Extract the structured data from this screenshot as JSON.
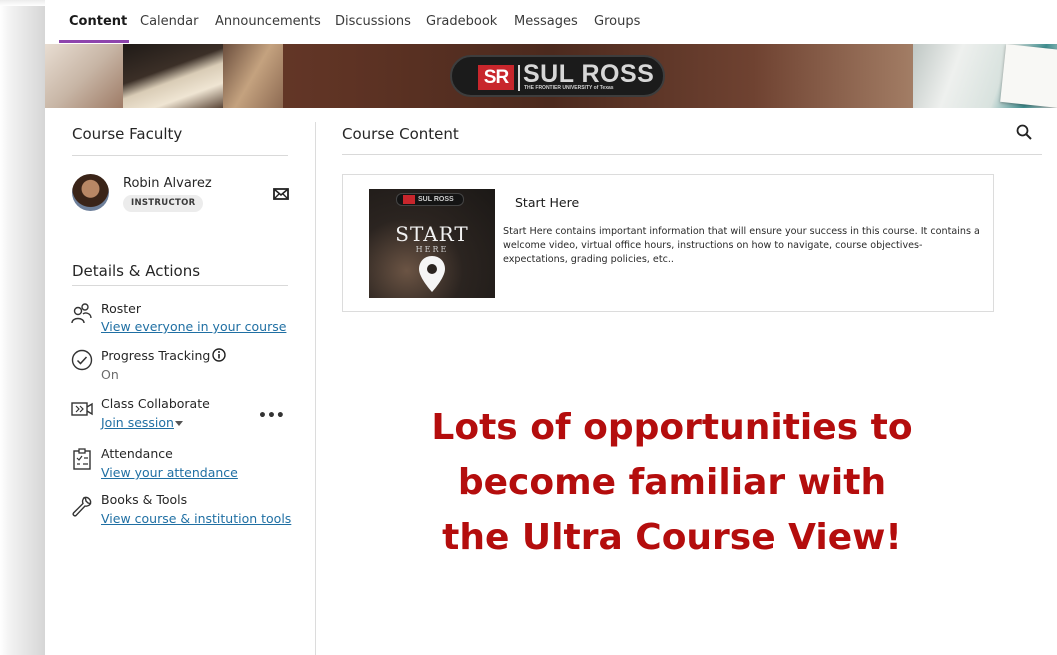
{
  "nav": {
    "tabs": [
      "Content",
      "Calendar",
      "Announcements",
      "Discussions",
      "Gradebook",
      "Messages",
      "Groups"
    ],
    "active_tab": "Content",
    "accent_color": "#8e44ad"
  },
  "banner": {
    "logo_mark": "SR",
    "logo_name": "SUL ROSS",
    "logo_tagline": "THE FRONTIER UNIVERSITY of Texas",
    "brand_color": "#c8262c"
  },
  "faculty": {
    "title": "Course Faculty",
    "name": "Robin Alvarez",
    "role": "INSTRUCTOR",
    "message_icon": "mail-icon"
  },
  "details": {
    "title": "Details & Actions",
    "items": [
      {
        "icon": "roster-icon",
        "title": "Roster",
        "link": "View everyone in your course"
      },
      {
        "icon": "progress-check-icon",
        "title": "Progress Tracking",
        "sub": "On",
        "info_icon": "info-icon"
      },
      {
        "icon": "collaborate-icon",
        "title": "Class Collaborate",
        "link": "Join session",
        "more": "•••"
      },
      {
        "icon": "attendance-icon",
        "title": "Attendance",
        "link": "View your attendance"
      },
      {
        "icon": "wrench-icon",
        "title": "Books & Tools",
        "link": "View course & institution tools"
      }
    ]
  },
  "content": {
    "title": "Course Content",
    "search_icon": "search-icon",
    "card": {
      "thumb_logo": "SUL ROSS",
      "thumb_title": "START",
      "thumb_sub": "HERE",
      "title": "Start Here",
      "description": "Start Here contains important information that will ensure your success in this course. It contains a welcome video, virtual office hours, instructions on how to navigate, course objectives-expectations, grading policies, etc.."
    }
  },
  "overlay": {
    "lines": [
      "Lots of opportunities to",
      "become familiar with",
      "the Ultra Course View!"
    ],
    "color": "#b40d0d"
  }
}
